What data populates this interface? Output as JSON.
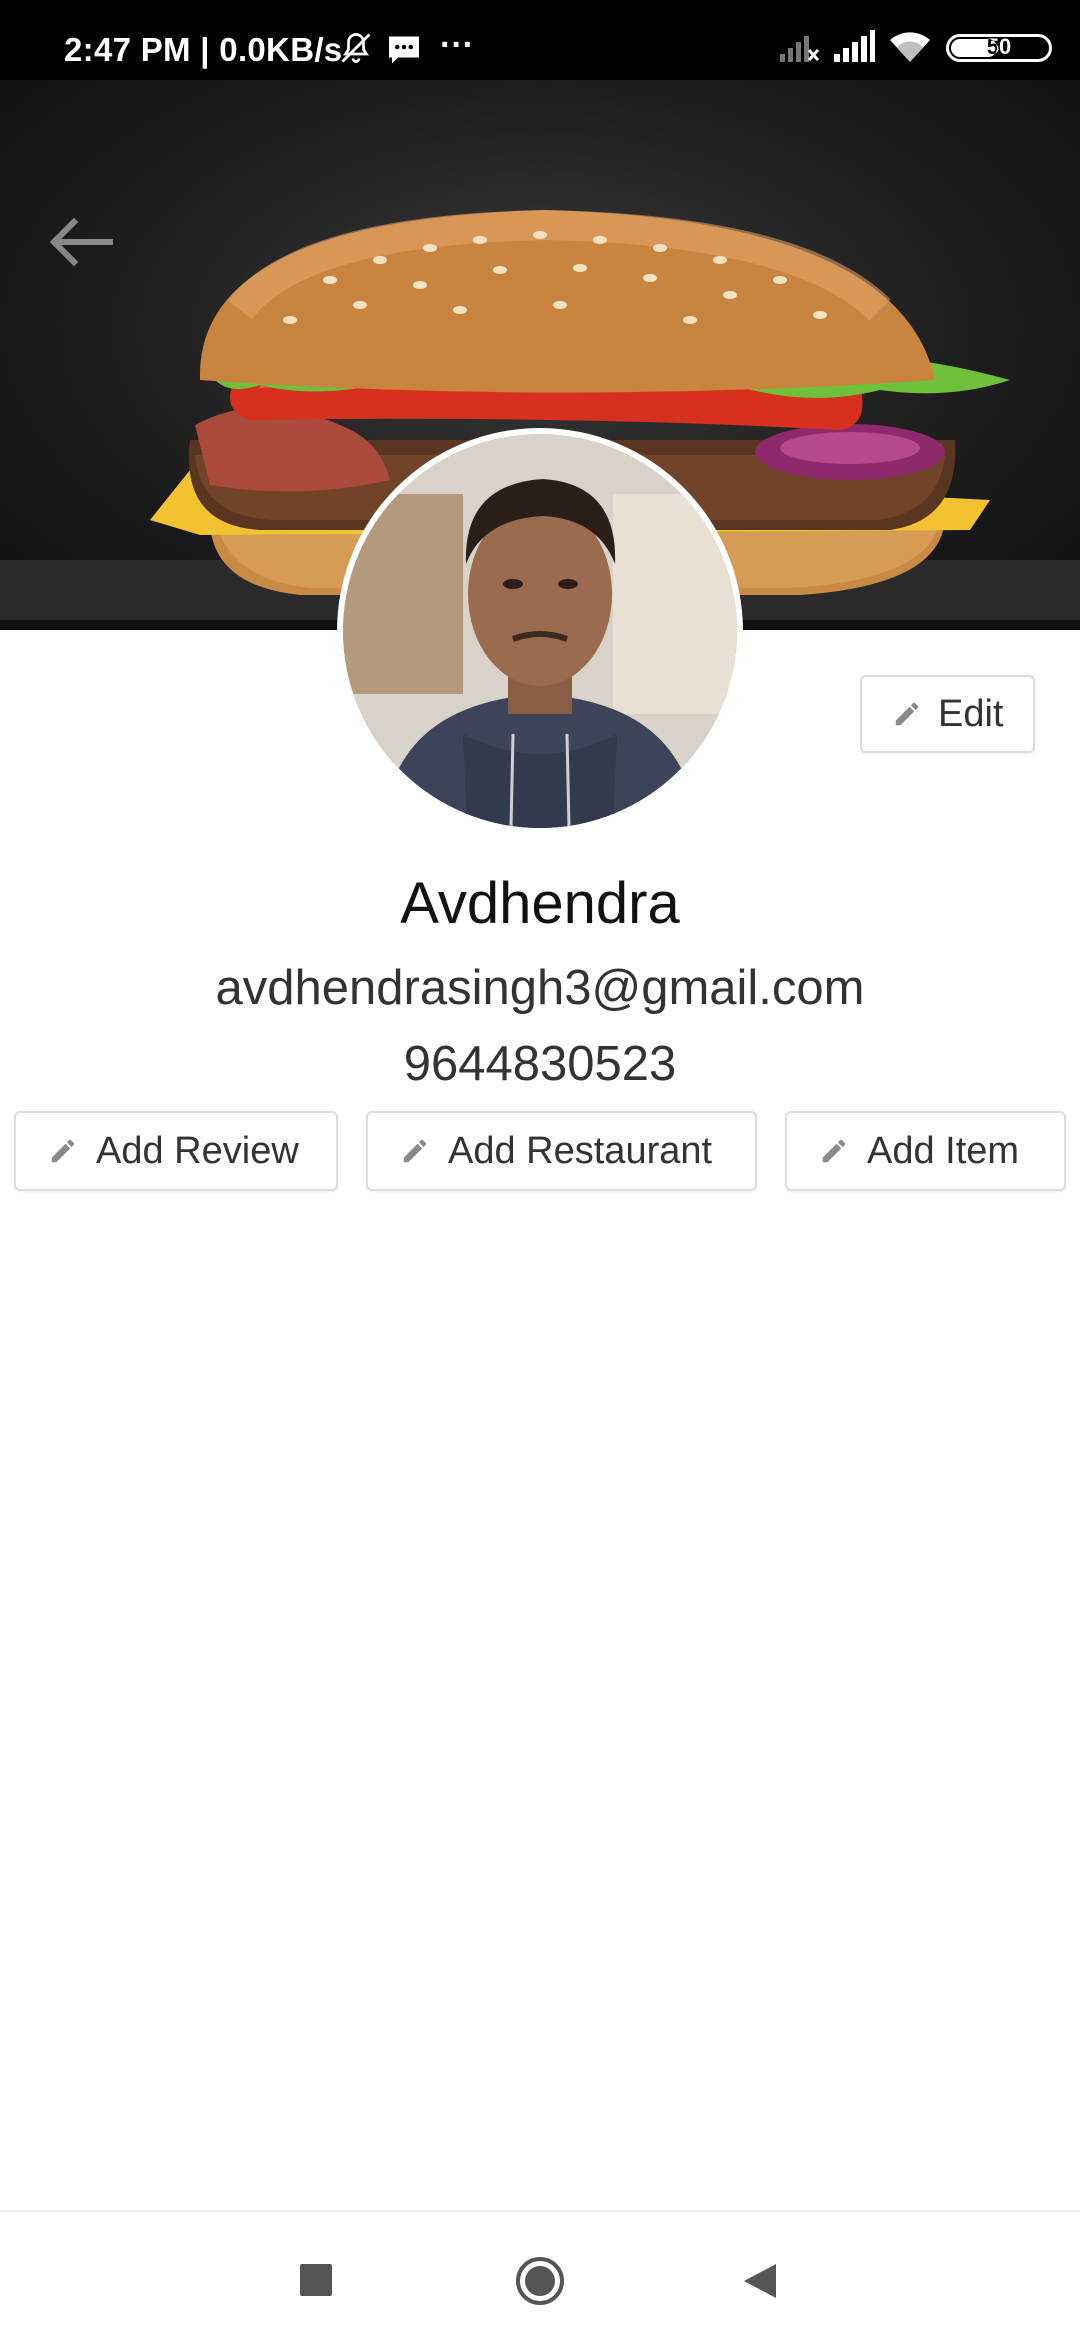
{
  "status_bar": {
    "time_speed": "2:47 PM | 0.0KB/s",
    "more": "···",
    "battery": "50",
    "icons": [
      "bell-off-icon",
      "message-icon",
      "signal-x-icon",
      "signal-icon",
      "wifi-icon",
      "battery-icon"
    ]
  },
  "banner": {
    "back_icon": "arrow-left-icon",
    "image": "burger-cover-photo"
  },
  "profile": {
    "avatar": "profile-photo",
    "edit_label": "Edit",
    "name": "Avdhendra",
    "email": "avdhendrasingh3@gmail.com",
    "phone": "9644830523"
  },
  "actions": [
    {
      "label": "Add Review",
      "icon": "pencil-icon"
    },
    {
      "label": "Add Restaurant",
      "icon": "pencil-icon"
    },
    {
      "label": "Add Item",
      "icon": "pencil-icon"
    }
  ],
  "nav_bar": {
    "icons": [
      "recent-apps-icon",
      "home-icon",
      "back-icon"
    ]
  },
  "colors": {
    "text_primary": "#111111",
    "text_secondary": "#333333",
    "border": "#dcdcdc",
    "status_bar": "#000000"
  }
}
